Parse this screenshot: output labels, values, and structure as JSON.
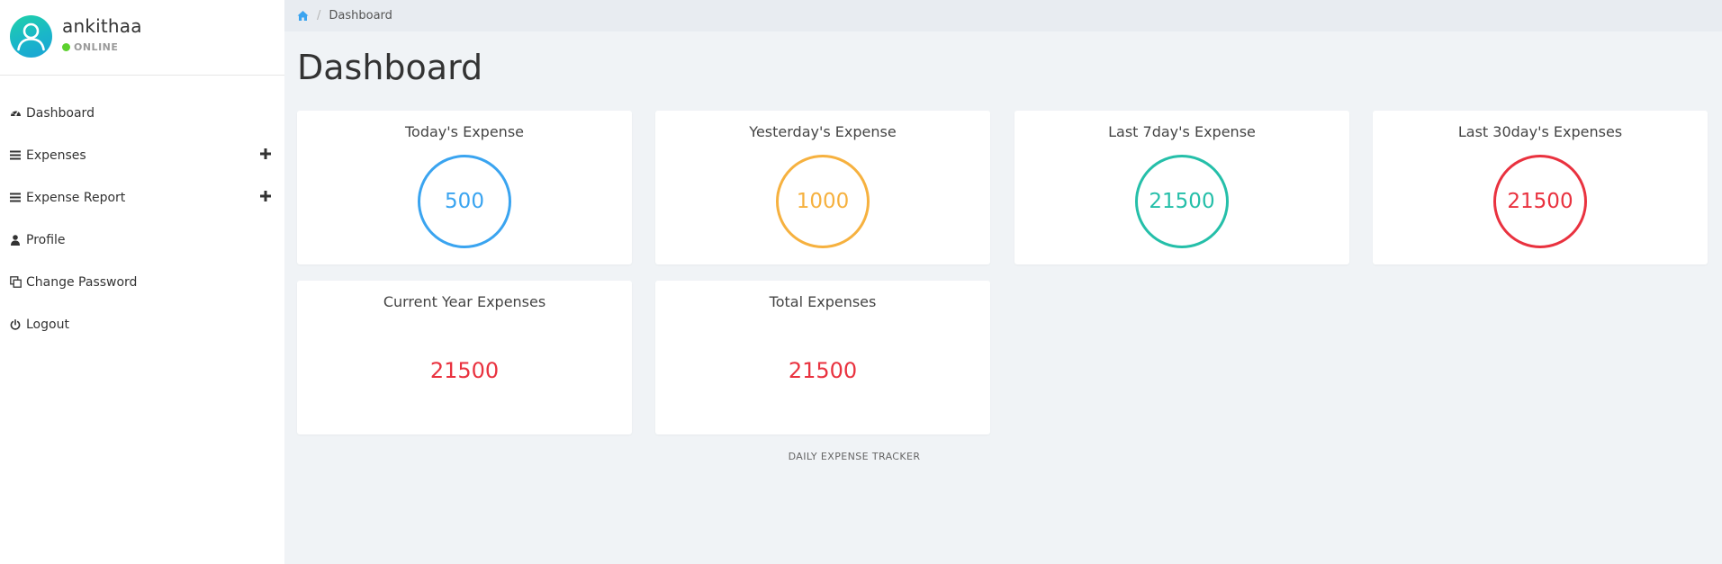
{
  "user": {
    "name": "ankithaa",
    "status": "ONLINE"
  },
  "sidebar": {
    "items": [
      {
        "label": "Dashboard",
        "icon": "dashboard-icon"
      },
      {
        "label": "Expenses",
        "icon": "bars-icon",
        "expandable": true
      },
      {
        "label": "Expense Report",
        "icon": "bars-icon",
        "expandable": true
      },
      {
        "label": "Profile",
        "icon": "user-icon"
      },
      {
        "label": "Change Password",
        "icon": "copy-icon"
      },
      {
        "label": "Logout",
        "icon": "power-icon"
      }
    ]
  },
  "breadcrumb": {
    "home_icon": "home-icon",
    "current": "Dashboard"
  },
  "page": {
    "title": "Dashboard"
  },
  "cards": [
    {
      "title": "Today's Expense",
      "value": "500",
      "color": "#3aa4f0",
      "style": "ring"
    },
    {
      "title": "Yesterday's Expense",
      "value": "1000",
      "color": "#f6b13f",
      "style": "ring"
    },
    {
      "title": "Last 7day's Expense",
      "value": "21500",
      "color": "#25bfa9",
      "style": "ring"
    },
    {
      "title": "Last 30day's Expenses",
      "value": "21500",
      "color": "#e9323f",
      "style": "ring"
    },
    {
      "title": "Current Year Expenses",
      "value": "21500",
      "color": "#e9323f",
      "style": "plain"
    },
    {
      "title": "Total Expenses",
      "value": "21500",
      "color": "#e9323f",
      "style": "plain"
    }
  ],
  "footer": {
    "text": "DAILY EXPENSE TRACKER"
  },
  "colors": {
    "accent": "#3aa4f0",
    "online": "#5cd12e",
    "main_bg": "#f0f3f6"
  }
}
